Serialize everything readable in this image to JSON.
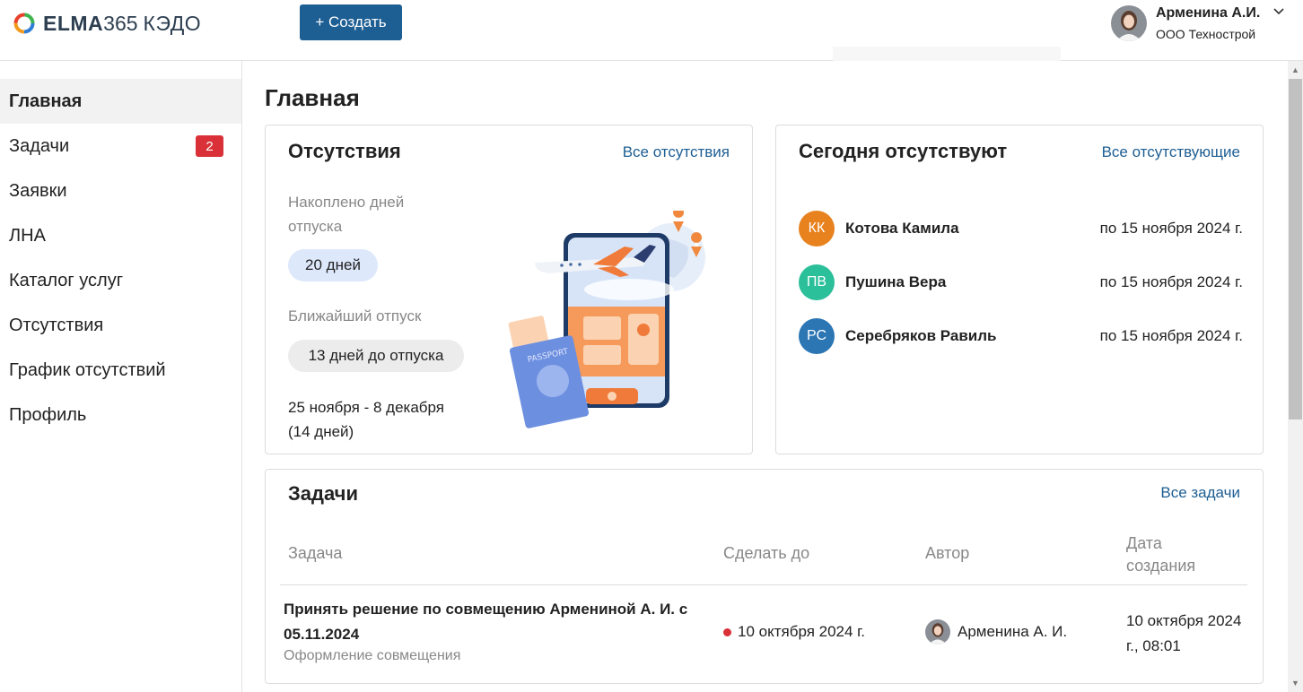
{
  "header": {
    "logo_brand": "ELMA",
    "logo_num": "365",
    "logo_product": "КЭДО",
    "create_label": "+ Создать",
    "user_name": "Арменина А.И.",
    "user_org": "ООО Технострой"
  },
  "sidebar": {
    "items": [
      {
        "label": "Главная",
        "active": true
      },
      {
        "label": "Задачи",
        "badge": "2"
      },
      {
        "label": "Заявки"
      },
      {
        "label": "ЛНА"
      },
      {
        "label": "Каталог услуг"
      },
      {
        "label": "Отсутствия"
      },
      {
        "label": "График отсутствий"
      },
      {
        "label": "Профиль"
      }
    ]
  },
  "main": {
    "title": "Главная",
    "absences": {
      "title": "Отсутствия",
      "link": "Все отсутствия",
      "accrued_label": "Накоплено дней отпуска",
      "accrued_value": "20 дней",
      "next_label": "Ближайший отпуск",
      "next_value": "13 дней до отпуска",
      "next_dates": "25 ноября - 8 декабря",
      "next_duration": "(14 дней)"
    },
    "today": {
      "title": "Сегодня отсутствуют",
      "link": "Все отсутствующие",
      "people": [
        {
          "initials": "КК",
          "name": "Котова Камила",
          "until": "по 15 ноября 2024 г.",
          "color": "#e8821e"
        },
        {
          "initials": "ПВ",
          "name": "Пушина Вера",
          "until": "по 15 ноября 2024 г.",
          "color": "#2bbf9a"
        },
        {
          "initials": "РС",
          "name": "Серебряков Равиль",
          "until": "по 15 ноября 2024 г.",
          "color": "#2c76b4"
        }
      ]
    },
    "tasks": {
      "title": "Задачи",
      "link": "Все задачи",
      "columns": [
        "Задача",
        "Сделать до",
        "Автор",
        "Дата создания"
      ],
      "rows": [
        {
          "title": "Принять решение по совмещению Армениной А. И. с 05.11.2024",
          "subtitle": "Оформление совмещения",
          "due": "10 октября 2024 г.",
          "author": "Арменина А. И.",
          "created": "10 октября 2024 г., 08:01"
        }
      ]
    }
  },
  "colors": {
    "accent": "#1d5e93",
    "badge": "#d93137",
    "overdue_dot": "#d93137"
  }
}
